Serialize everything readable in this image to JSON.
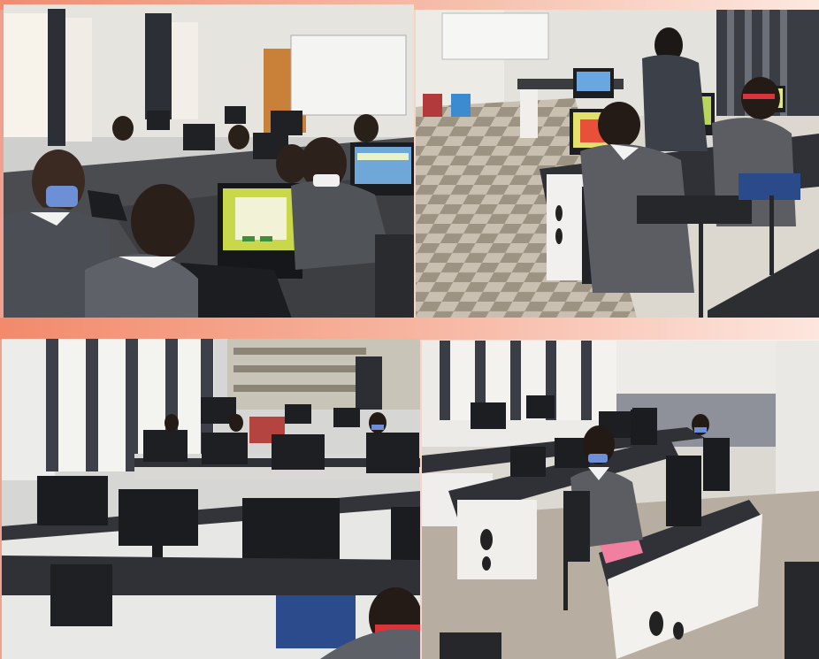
{
  "collage": {
    "photos": [
      {
        "id": "top-left",
        "subject": "students-at-computers"
      },
      {
        "id": "top-right",
        "subject": "students-at-computers"
      },
      {
        "id": "bottom-left",
        "subject": "empty-computer-lab"
      },
      {
        "id": "bottom-right",
        "subject": "student-at-workstation"
      }
    ]
  },
  "colors": {
    "accent": "#f28a6c",
    "uniform_grey": "#5a5c62",
    "desk_white": "#e9e9e7",
    "desk_top": "#3a3d42",
    "screen_green": "#b8d65a",
    "mask_blue": "#6d8fd6"
  }
}
